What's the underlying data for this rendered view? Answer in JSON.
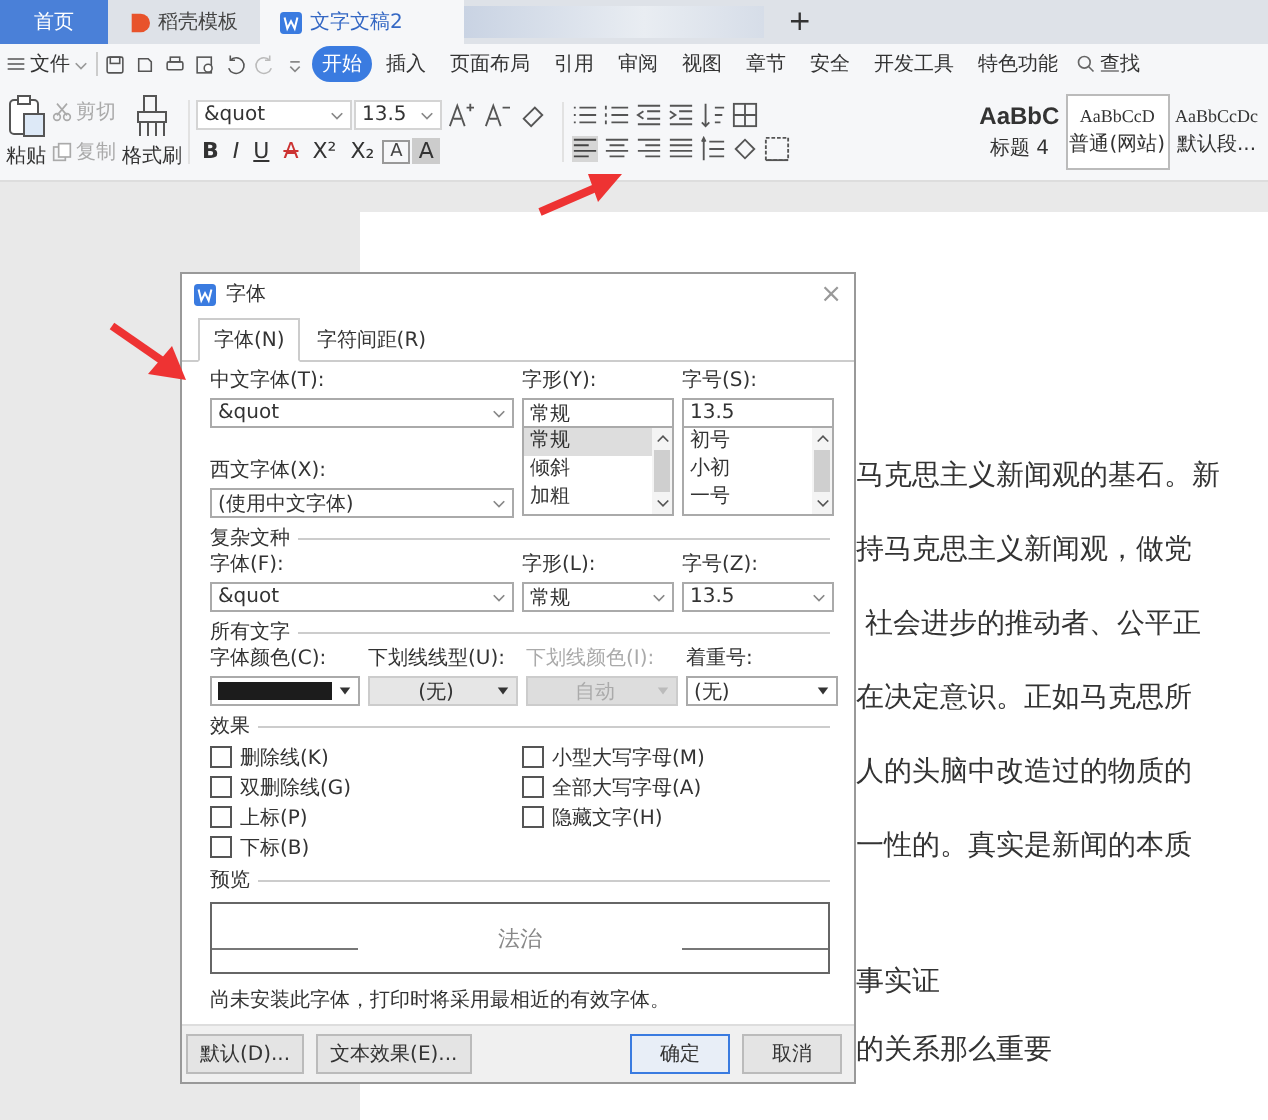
{
  "browser_tabs": [
    {
      "label": "首页",
      "kind": "home",
      "selected": false
    },
    {
      "label": "稻壳模板",
      "kind": "template",
      "selected": false
    },
    {
      "label": "文字文稿2",
      "kind": "document",
      "selected": true
    }
  ],
  "new_tab": "+",
  "menu": {
    "file": "文件",
    "items": [
      {
        "label": "开始",
        "selected": true
      },
      {
        "label": "插入",
        "selected": false
      },
      {
        "label": "页面布局",
        "selected": false
      },
      {
        "label": "引用",
        "selected": false
      },
      {
        "label": "审阅",
        "selected": false
      },
      {
        "label": "视图",
        "selected": false
      },
      {
        "label": "章节",
        "selected": false
      },
      {
        "label": "安全",
        "selected": false
      },
      {
        "label": "开发工具",
        "selected": false
      },
      {
        "label": "特色功能",
        "selected": false
      }
    ],
    "search": "查找"
  },
  "toolbar": {
    "paste": "粘贴",
    "cut": "剪切",
    "copy": "复制",
    "format_painter": "格式刷",
    "font": "&quot",
    "size": "13.5",
    "format_buttons": [
      "B",
      "I",
      "U",
      "A",
      "X²",
      "X₂",
      "A",
      "A"
    ],
    "styles": [
      {
        "preview": "AaBbC",
        "name": "标题 4",
        "kind": "heading",
        "selected": false
      },
      {
        "preview": "AaBbCcD",
        "name": "普通(网站)",
        "kind": "normal",
        "selected": true
      },
      {
        "preview": "AaBbCcDc",
        "name": "默认段...",
        "kind": "normal",
        "selected": false
      }
    ]
  },
  "document": {
    "lines": [
      "马克思主义新闻观的基石。新",
      "持马克思主义新闻观，做党",
      " 社会进步的推动者、公平正",
      "在决定意识。正如马克思所",
      "人的头脑中改造过的物质的",
      "一性的。真实是新闻的本质"
    ],
    "lower_lines": [
      "事实证",
      "的关系那么重要"
    ]
  },
  "dialog": {
    "title": "字体",
    "close": "×",
    "tabs": [
      {
        "label": "字体(N)",
        "selected": true
      },
      {
        "label": "字符间距(R)",
        "selected": false
      }
    ],
    "chinese_font": {
      "label": "中文字体(T):",
      "value": "&quot"
    },
    "western_font": {
      "label": "西文字体(X):",
      "value": "(使用中文字体)"
    },
    "style": {
      "label": "字形(Y):",
      "value": "常规",
      "options": [
        {
          "label": "常规",
          "selected": true
        },
        {
          "label": "倾斜",
          "selected": false
        },
        {
          "label": "加粗",
          "selected": false
        }
      ]
    },
    "size": {
      "label": "字号(S):",
      "value": "13.5",
      "options": [
        {
          "label": "初号",
          "selected": false
        },
        {
          "label": "小初",
          "selected": false
        },
        {
          "label": "一号",
          "selected": false
        }
      ]
    },
    "complex": {
      "heading": "复杂文种",
      "fields": [
        {
          "label": "字体(F):",
          "value": "&quot"
        },
        {
          "label": "字形(L):",
          "value": "常规"
        },
        {
          "label": "字号(Z):",
          "value": "13.5"
        }
      ]
    },
    "all_text": {
      "heading": "所有文字",
      "font_color": {
        "label": "字体颜色(C):",
        "color": "#1c1c1c"
      },
      "fields": [
        {
          "label": "下划线线型(U):",
          "value": "(无)",
          "disabled": false
        },
        {
          "label": "下划线颜色(I):",
          "value": "自动",
          "disabled": true
        },
        {
          "label": "着重号:",
          "value": "(无)",
          "disabled": false
        }
      ]
    },
    "effects": {
      "heading": "效果",
      "options": [
        {
          "label": "删除线(K)",
          "checked": false
        },
        {
          "label": "小型大写字母(M)",
          "checked": false
        },
        {
          "label": "双删除线(G)",
          "checked": false
        },
        {
          "label": "全部大写字母(A)",
          "checked": false
        },
        {
          "label": "上标(P)",
          "checked": false
        },
        {
          "label": "隐藏文字(H)",
          "checked": false
        },
        {
          "label": "下标(B)",
          "checked": false
        }
      ]
    },
    "preview": {
      "heading": "预览",
      "sample": "法治",
      "note": "尚未安装此字体，打印时将采用最相近的有效字体。"
    },
    "buttons": [
      {
        "label": "默认(D)...",
        "kind": "secondary"
      },
      {
        "label": "文本效果(E)...",
        "kind": "secondary"
      },
      {
        "label": "确定",
        "kind": "primary"
      },
      {
        "label": "取消",
        "kind": "secondary"
      }
    ]
  }
}
